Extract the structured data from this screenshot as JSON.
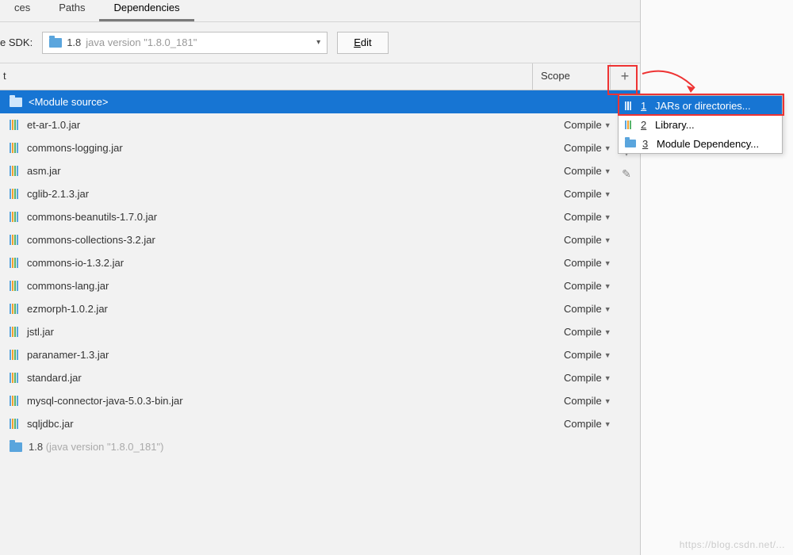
{
  "tabs": {
    "left": "ces",
    "paths": "Paths",
    "deps": "Dependencies"
  },
  "sdk": {
    "label": "e SDK:",
    "version": "1.8",
    "desc": "java version \"1.8.0_181\"",
    "edit_prefix": "E",
    "edit_suffix": "dit"
  },
  "header": {
    "export": "t",
    "scope": "Scope"
  },
  "module_row": {
    "label": "<Module source>"
  },
  "scope_label": "Compile",
  "jars": [
    "et-ar-1.0.jar",
    "commons-logging.jar",
    "asm.jar",
    "cglib-2.1.3.jar",
    "commons-beanutils-1.7.0.jar",
    "commons-collections-3.2.jar",
    "commons-io-1.3.2.jar",
    "commons-lang.jar",
    "ezmorph-1.0.2.jar",
    "jstl.jar",
    "paranamer-1.3.jar",
    "standard.jar",
    "mysql-connector-java-5.0.3-bin.jar",
    "sqljdbc.jar"
  ],
  "sdk_row": {
    "version": "1.8",
    "desc": "(java version \"1.8.0_181\")"
  },
  "popup": {
    "i1": {
      "num": "1",
      "label": "JARs or directories..."
    },
    "i2": {
      "num": "2",
      "label": "Library..."
    },
    "i3": {
      "num": "3",
      "label": "Module Dependency..."
    }
  },
  "watermark": "https://blog.csdn.net/..."
}
